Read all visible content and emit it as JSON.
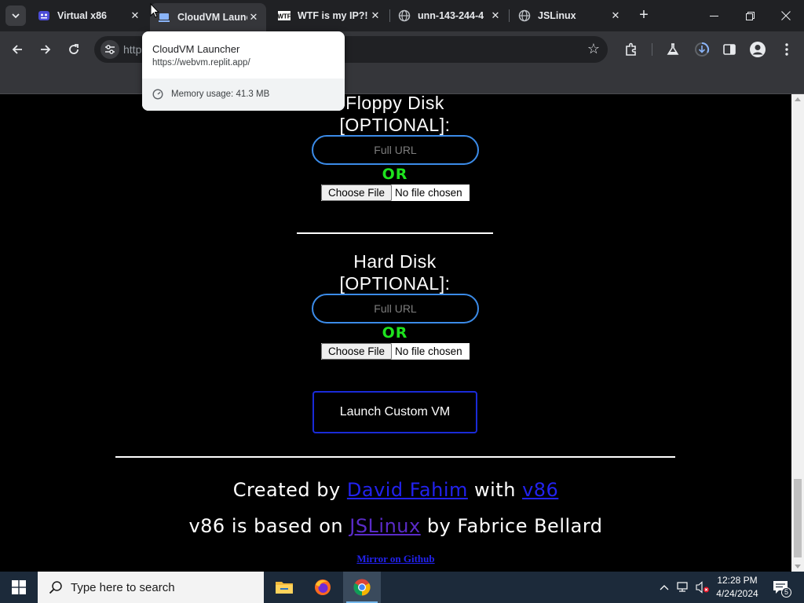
{
  "browser": {
    "tabs": [
      {
        "title": "Virtual x86",
        "active": false
      },
      {
        "title": "CloudVM Launcher",
        "active": true
      },
      {
        "title": "WTF is my IP?!",
        "active": false
      },
      {
        "title": "unn-143-244-4",
        "active": false
      },
      {
        "title": "JSLinux",
        "active": false
      }
    ],
    "address_text": "http"
  },
  "hovercard": {
    "title": "CloudVM Launcher",
    "url": "https://webvm.replit.app/",
    "memory": "Memory usage: 41.3 MB"
  },
  "page": {
    "floppy": {
      "heading_line1": "Floppy Disk",
      "heading_line2": "[OPTIONAL]:",
      "url_placeholder": "Full URL",
      "or_label": "OR",
      "file_button": "Choose File",
      "file_status": "No file chosen"
    },
    "harddisk": {
      "heading_line1": "Hard Disk",
      "heading_line2": "[OPTIONAL]:",
      "url_placeholder": "Full URL",
      "or_label": "OR",
      "file_button": "Choose File",
      "file_status": "No file chosen"
    },
    "launch_button": "Launch Custom VM",
    "credits": {
      "line1_prefix": "Created by ",
      "author_link": "David Fahim",
      "line1_middle": " with ",
      "v86_link": "v86",
      "line2_prefix": "v86 is based on ",
      "jslinux_link": "JSLinux",
      "line2_suffix": " by Fabrice Bellard",
      "mirror_link": "Mirror on Github"
    }
  },
  "taskbar": {
    "search_placeholder": "Type here to search",
    "time": "12:28 PM",
    "date": "4/24/2024",
    "notification_count": "5"
  },
  "colors": {
    "accent_green": "#1ee31e",
    "link_blue": "#2222ee",
    "input_border": "#3b8be8",
    "button_border": "#1a2bd8"
  }
}
